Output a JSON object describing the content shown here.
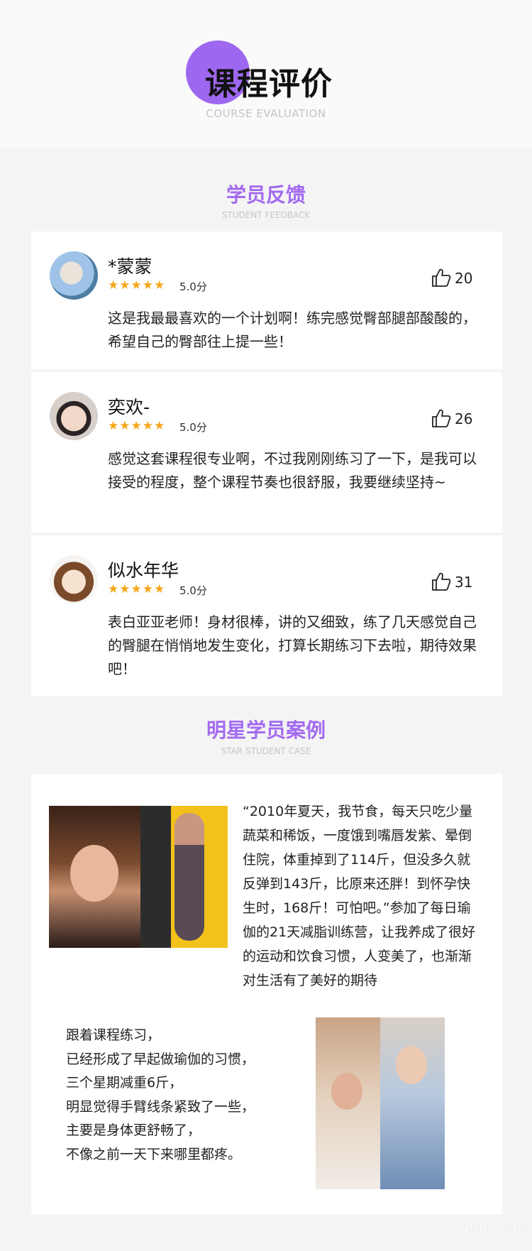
{
  "header": {
    "title": "课程评价",
    "subtitle": "COURSE EVALUATION"
  },
  "feedback": {
    "title": "学员反馈",
    "subtitle": "STUDENT FEEDBACK",
    "items": [
      {
        "name": "*蒙蒙",
        "stars": "★★★★★",
        "score": "5.0分",
        "rating": 5,
        "likes": "20",
        "comment": "这是我最最喜欢的一个计划啊！练完感觉臀部腿部酸酸的，希望自己的臀部往上提一些！"
      },
      {
        "name": "奕欢-",
        "stars": "★★★★★",
        "score": "5.0分",
        "rating": 5,
        "likes": "26",
        "comment": "感觉这套课程很专业啊，不过我刚刚练习了一下，是我可以接受的程度，整个课程节奏也很舒服，我要继续坚持~"
      },
      {
        "name": "似水年华",
        "stars": "★★★★★",
        "score": "5.0分",
        "rating": 5,
        "likes": "31",
        "comment": "表白亚亚老师！身材很棒，讲的又细致，练了几天感觉自己的臀腿在悄悄地发生变化，打算长期练习下去啦，期待效果吧！"
      }
    ]
  },
  "star_case": {
    "title": "明星学员案例",
    "subtitle": "STAR STUDENT CASE",
    "story1": "“2010年夏天，我节食，每天只吃少量蔬菜和稀饭，一度饿到嘴唇发紫、晕倒住院，体重掉到了114斤，但没多久就反弹到143斤，比原来还胖！到怀孕快生时，168斤！可怕吧。”参加了每日瑜伽的21天减脂训练营，让我养成了很好的运动和饮食习惯，人变美了，也渐渐对生活有了美好的期待",
    "story2_lines": [
      "跟着课程练习，",
      "已经形成了早起做瑜伽的习惯，",
      "三个星期减重6斤，",
      "明显觉得手臂线条紧致了一些，",
      "主要是身体更舒畅了，",
      "不像之前一天下来哪里都疼。"
    ]
  },
  "watermark": "QGPX.COM",
  "colors": {
    "accent": "#a26af0",
    "star": "#f7a51a"
  }
}
